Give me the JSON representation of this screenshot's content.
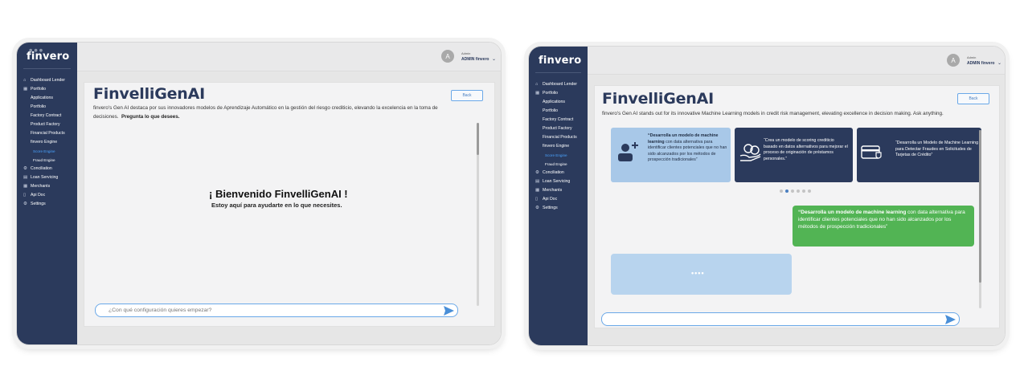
{
  "brand": {
    "logo": "finvero"
  },
  "user": {
    "initial": "A",
    "role": "Admin",
    "name": "ADMIN finvero"
  },
  "nav": [
    {
      "label": "Dashboard Lender",
      "icon": "home-icon",
      "level": 0
    },
    {
      "label": "Portfolio",
      "icon": "grid-icon",
      "level": 0
    },
    {
      "label": "Applications",
      "icon": "",
      "level": 1
    },
    {
      "label": "Portfolio",
      "icon": "",
      "level": 1
    },
    {
      "label": "Factory Contract",
      "icon": "",
      "level": 1
    },
    {
      "label": "Product Factory",
      "icon": "",
      "level": 1
    },
    {
      "label": "Financial Products",
      "icon": "",
      "level": 1
    },
    {
      "label": "finvero Engine",
      "icon": "",
      "level": 1
    },
    {
      "label": "Score Engine",
      "icon": "",
      "level": 2,
      "active": true
    },
    {
      "label": "Fraud Engine",
      "icon": "",
      "level": 2
    },
    {
      "label": "Conciliation",
      "icon": "gear-icon",
      "level": 0
    },
    {
      "label": "Loan Servicing",
      "icon": "doc-icon",
      "level": 0
    },
    {
      "label": "Merchants",
      "icon": "grid-icon",
      "level": 0
    },
    {
      "label": "Api Doc",
      "icon": "file-icon",
      "level": 0
    },
    {
      "label": "Settings",
      "icon": "settings-icon",
      "level": 0
    }
  ],
  "screen1": {
    "title": "FinvelliGenAI",
    "back_label": "Back",
    "description": "finvero's Gen AI destaca por sus innovadores modelos de Aprendizaje Automático en la gestión del riesgo crediticio, elevando la excelencia en la toma de decisiones.",
    "description_bold": "Pregunta lo que desees.",
    "welcome_title": "¡ Bienvenido FinvelliGenAI !",
    "welcome_sub": "Estoy aquí para ayudarte en lo que necesites.",
    "input_placeholder": "¿Con qué configuración quieres empezar?"
  },
  "screen2": {
    "title": "FinvelliGenAI",
    "back_label": "Back",
    "description": "finvero's Gen AI stands out for its innovative Machine Learning models in credit risk management, elevating excellence in decision making. Ask anything.",
    "cards": [
      {
        "bold": "“Desarrolla un modelo de machine learning",
        "text": " con data alternativa para identificar clientes potenciales que no han sido alcanzados por los métodos de prospección tradicionales”",
        "icon": "user-add-icon",
        "style": "light"
      },
      {
        "bold": "",
        "text": "“Crea un modelo de scoring crediticio basado en datos alternativos para mejorar el proceso de originación de préstamos personales.”",
        "icon": "hand-coins-icon",
        "style": "dark"
      },
      {
        "bold": "",
        "text": "“Desarrolla un Modelo de Machine Learning para Detectar Fraudes en Solicitudes de Tarjetas de Crédito”",
        "icon": "card-shield-icon",
        "style": "dark"
      }
    ],
    "carousel_pages": 6,
    "carousel_active": 1,
    "message_bold": "“Desarrolla un modelo de machine learning",
    "message_text": " con data alternativa para identificar clientes potenciales que no han sido alcanzados por los métodos de prospección tradicionales”",
    "typing": "••••",
    "input_placeholder": ""
  },
  "colors": {
    "sidebar": "#2b3a5c",
    "accent": "#4a7fc0",
    "user_bubble": "#52b454",
    "bot_bubble": "#b8d4ee"
  }
}
